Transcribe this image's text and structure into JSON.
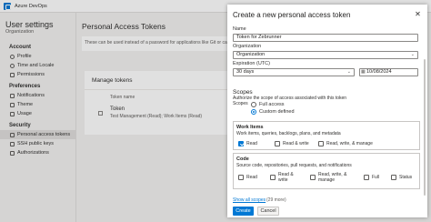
{
  "header": {
    "brand": "Azure DevOps"
  },
  "leftnav": {
    "title": "User settings",
    "subtitle": "Organization",
    "sections": [
      {
        "title": "Account",
        "items": [
          "Profile",
          "Time and Locale",
          "Permissions"
        ]
      },
      {
        "title": "Preferences",
        "items": [
          "Notifications",
          "Theme",
          "Usage"
        ]
      },
      {
        "title": "Security",
        "items": [
          "Personal access tokens",
          "SSH public keys",
          "Authorizations"
        ]
      }
    ]
  },
  "main": {
    "title": "Personal Access Tokens",
    "description": "These can be used instead of a password for applications like Git or can be passed in the authorization header to access REST APIs",
    "tokens_heading": "Manage tokens",
    "column_header": "Token name",
    "token_name": "Token",
    "token_detail": "Test Management (Read); Work Items (Read)"
  },
  "panel": {
    "title": "Create a new personal access token",
    "close": "✕",
    "name_label": "Name",
    "name_value": "Token for Zebrunner",
    "org_label": "Organization",
    "org_value": "Organization",
    "expiration_label": "Expiration (UTC)",
    "expiration_value": "30 days",
    "expiration_date": "10/08/2024",
    "scopes_title": "Scopes",
    "scopes_desc": "Authorize the scope of access associated with this token",
    "scopes_label": "Scopes",
    "full_access": "Full access",
    "custom_defined": "Custom defined",
    "work_items": {
      "title": "Work Items",
      "desc": "Work items, queries, backlogs, plans, and metadata",
      "options": [
        "Read",
        "Read & write",
        "Read, write, & manage"
      ]
    },
    "code": {
      "title": "Code",
      "desc": "Source code, repositories, pull requests, and notifications",
      "options": [
        "Read",
        "Read & write",
        "Read, write, & manage",
        "Full",
        "Status"
      ]
    },
    "show_all": "Show all scopes",
    "show_count": "(29 more)",
    "create": "Create",
    "cancel": "Cancel"
  }
}
